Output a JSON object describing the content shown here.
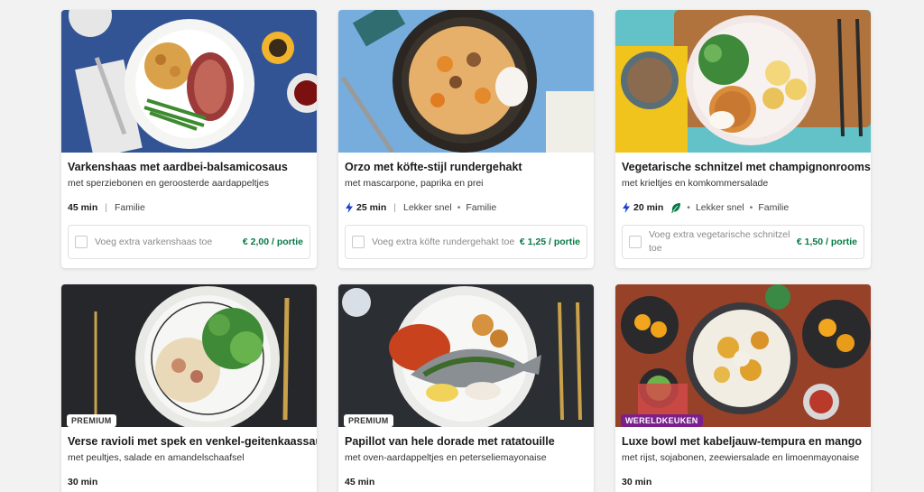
{
  "recipes": [
    {
      "title": "Varkenshaas met aardbei-balsamicosaus",
      "subtitle": "met sperziebonen en geroosterde aardappeltjes",
      "time": "45 min",
      "quick": false,
      "tags": [
        "Familie"
      ],
      "extra_label": "Voeg extra varkenshaas toe",
      "extra_price": "€ 2,00 / portie"
    },
    {
      "title": "Orzo met köfte-stijl rundergehakt",
      "subtitle": "met mascarpone, paprika en prei",
      "time": "25 min",
      "quick": true,
      "tags": [
        "Lekker snel",
        "Familie"
      ],
      "extra_label": "Voeg extra köfte rundergehakt toe",
      "extra_price": "€ 1,25 / portie"
    },
    {
      "title": "Vegetarische schnitzel met champignonroomsaus",
      "subtitle": "met krieltjes en komkommersalade",
      "time": "20 min",
      "quick": true,
      "veggie": true,
      "tags": [
        "Lekker snel",
        "Familie"
      ],
      "extra_label": "Voeg extra vegetarische schnitzel toe",
      "extra_price": "€ 1,50 / portie"
    },
    {
      "title": "Verse ravioli met spek en venkel-geitenkaassaus",
      "subtitle": "met peultjes, salade en amandelschaafsel",
      "time": "30 min",
      "badge": "PREMIUM"
    },
    {
      "title": "Papillot van hele dorade met ratatouille",
      "subtitle": "met oven-aardappeltjes en peterseliemayonaise",
      "time": "45 min",
      "badge": "PREMIUM"
    },
    {
      "title": "Luxe bowl met kabeljauw-tempura en mango",
      "subtitle": "met rijst, sojabonen, zeewiersalade en limoenmayonaise",
      "time": "30 min",
      "badge": "WERELDKEUKEN"
    }
  ],
  "colors": {
    "price_green": "#067a46",
    "bolt_blue": "#1a3fd6",
    "leaf_green": "#067a46",
    "badge_world": "#7a1f8c"
  },
  "icons": {
    "quick": "lightning-bolt-icon",
    "veggie": "leaf-icon",
    "checkbox": "checkbox-icon"
  }
}
